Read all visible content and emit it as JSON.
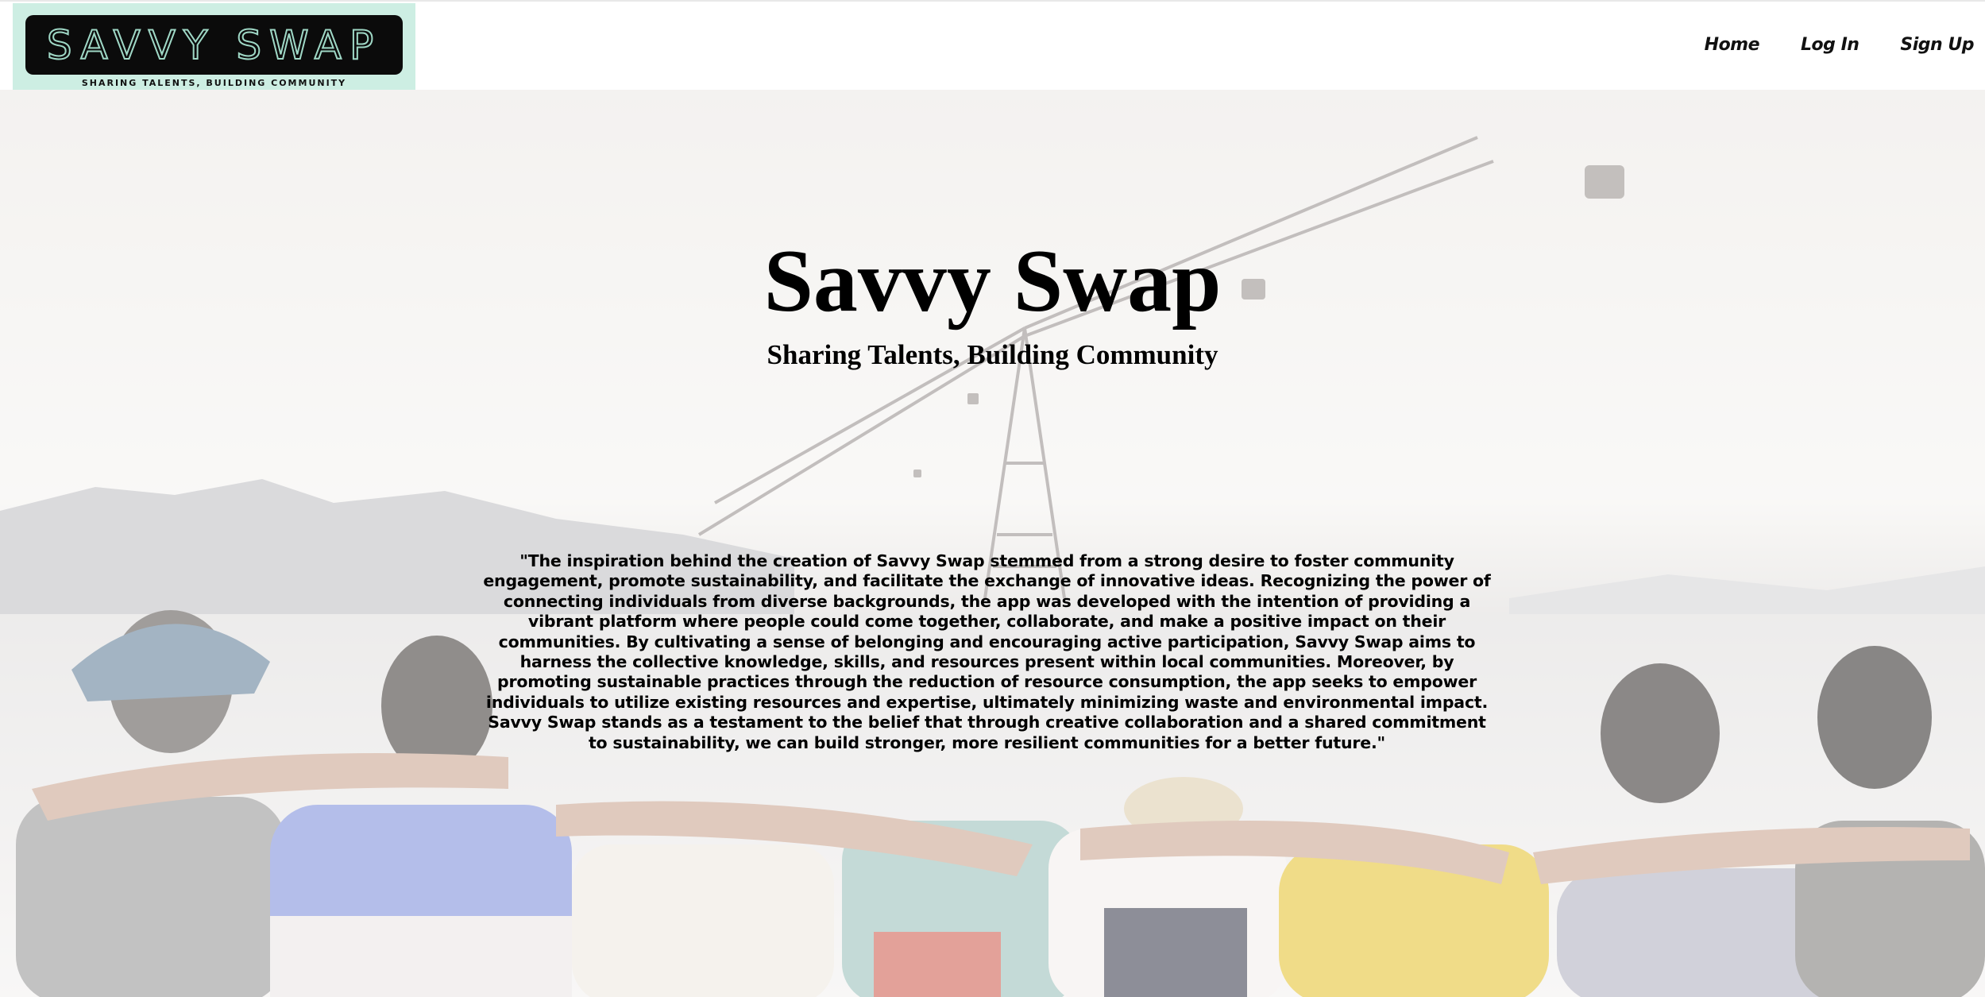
{
  "navbar": {
    "logo": {
      "wordmark": "SAVVY SWAP",
      "tagline": "SHARING TALENTS, BUILDING COMMUNITY"
    },
    "links": [
      {
        "label": "Home"
      },
      {
        "label": "Log In"
      },
      {
        "label": "Sign Up"
      }
    ]
  },
  "hero": {
    "title": "Savvy Swap",
    "subtitle": "Sharing Talents, Building Community",
    "quote": "\"The inspiration behind the creation of Savvy Swap stemmed from a strong desire to foster community engagement, promote sustainability, and facilitate the exchange of innovative ideas. Recognizing the power of connecting individuals from diverse backgrounds, the app was developed with the intention of providing a vibrant platform where people could come together, collaborate, and make a positive impact on their communities. By cultivating a sense of belonging and encouraging active participation, Savvy Swap aims to harness the collective knowledge, skills, and resources present within local communities. Moreover, by promoting sustainable practices through the reduction of resource consumption, the app seeks to empower individuals to utilize existing resources and expertise, ultimately minimizing waste and environmental impact. Savvy Swap stands as a testament to the belief that through creative collaboration and a shared commitment to sustainability, we can build stronger, more resilient communities for a better future.\"",
    "background_image": "group-of-friends-arm-in-arm-by-the-sea-with-cable-cars"
  },
  "colors": {
    "logo_background": "#cdeee3",
    "logo_box": "#0b0b0b",
    "logo_outline": "#9fd8c6",
    "nav_background": "#ffffff",
    "text": "#000000"
  }
}
